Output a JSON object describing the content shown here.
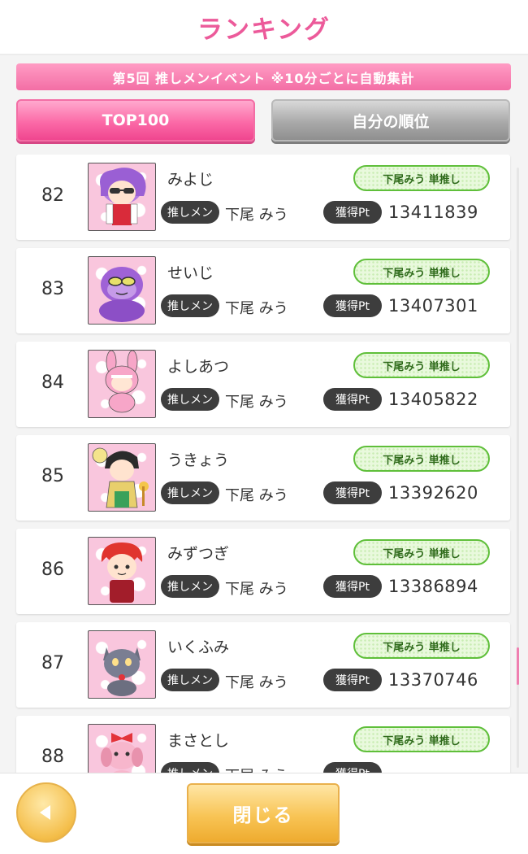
{
  "header": {
    "title": "ランキング"
  },
  "event_banner": {
    "text": "第5回 推しメンイベント ※10分ごとに自動集計"
  },
  "tabs": [
    {
      "label": "TOP100",
      "active": true
    },
    {
      "label": "自分の順位",
      "active": false
    }
  ],
  "labels": {
    "oshi_badge": "推しメン",
    "pt_badge": "獲得Pt",
    "single_tag": "下尾みう 単推し"
  },
  "rankings": [
    {
      "rank": "82",
      "name": "みよじ",
      "oshi": "下尾 みう",
      "points": "13411839",
      "avatar_icon": "purple-hair-sunglasses-avatar"
    },
    {
      "rank": "83",
      "name": "せいじ",
      "oshi": "下尾 みう",
      "points": "13407301",
      "avatar_icon": "purple-gorilla-avatar"
    },
    {
      "rank": "84",
      "name": "よしあつ",
      "oshi": "下尾 みう",
      "points": "13405822",
      "avatar_icon": "pink-rabbit-costume-avatar"
    },
    {
      "rank": "85",
      "name": "うきょう",
      "oshi": "下尾 みう",
      "points": "13392620",
      "avatar_icon": "kimono-avatar"
    },
    {
      "rank": "86",
      "name": "みずつぎ",
      "oshi": "下尾 みう",
      "points": "13386894",
      "avatar_icon": "red-hair-avatar"
    },
    {
      "rank": "87",
      "name": "いくふみ",
      "oshi": "下尾 みう",
      "points": "13370746",
      "avatar_icon": "gray-cat-avatar"
    },
    {
      "rank": "88",
      "name": "まさとし",
      "oshi": "下尾 みう",
      "points": "",
      "avatar_icon": "pink-dog-bow-avatar"
    }
  ],
  "footer": {
    "close_label": "閉じる",
    "back_icon": "back-arrow-icon"
  },
  "colors": {
    "accent_pink": "#ec5a9a",
    "tag_green": "#5fbf3a",
    "button_gold": "#f4be4a"
  }
}
